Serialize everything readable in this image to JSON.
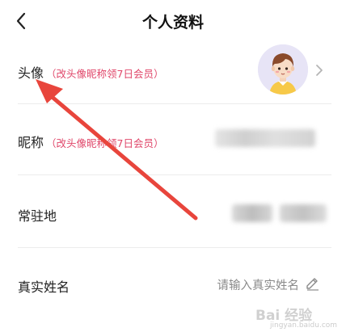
{
  "header": {
    "back_icon": "chevron-left-icon",
    "title": "个人资料"
  },
  "rows": {
    "avatar": {
      "label": "头像",
      "hint": "（改头像昵称领7日会员）"
    },
    "nickname": {
      "label": "昵称",
      "hint": "（改头像昵称领7日会员）"
    },
    "residence": {
      "label": "常驻地"
    },
    "real_name": {
      "label": "真实姓名",
      "placeholder": "请输入真实姓名"
    }
  },
  "colors": {
    "hint": "#e0476a",
    "annotation_arrow": "#e8453c",
    "avatar_bg": "#e7e4f6"
  },
  "watermark": {
    "text": "Bai 经验",
    "sub": "jingyan.baidu.com"
  }
}
